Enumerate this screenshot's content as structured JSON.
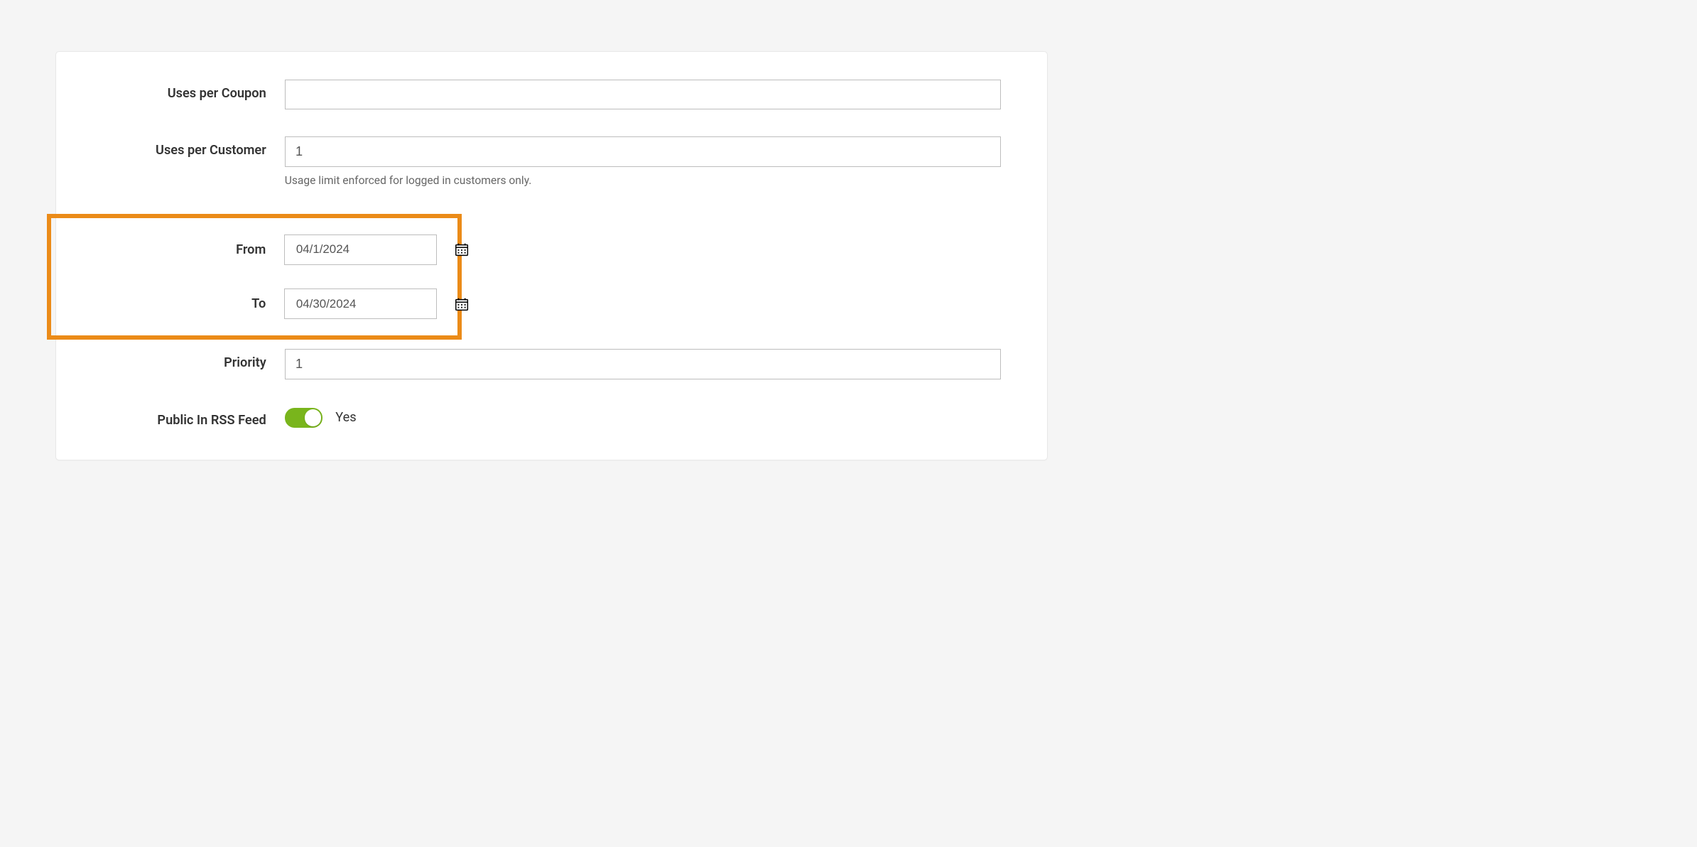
{
  "fields": {
    "uses_per_coupon": {
      "label": "Uses per Coupon",
      "value": ""
    },
    "uses_per_customer": {
      "label": "Uses per Customer",
      "value": "1",
      "helper": "Usage limit enforced for logged in customers only."
    },
    "from": {
      "label": "From",
      "value": "04/1/2024"
    },
    "to": {
      "label": "To",
      "value": "04/30/2024"
    },
    "priority": {
      "label": "Priority",
      "value": "1"
    },
    "rss": {
      "label": "Public In RSS Feed",
      "value_label": "Yes",
      "on": true
    }
  }
}
